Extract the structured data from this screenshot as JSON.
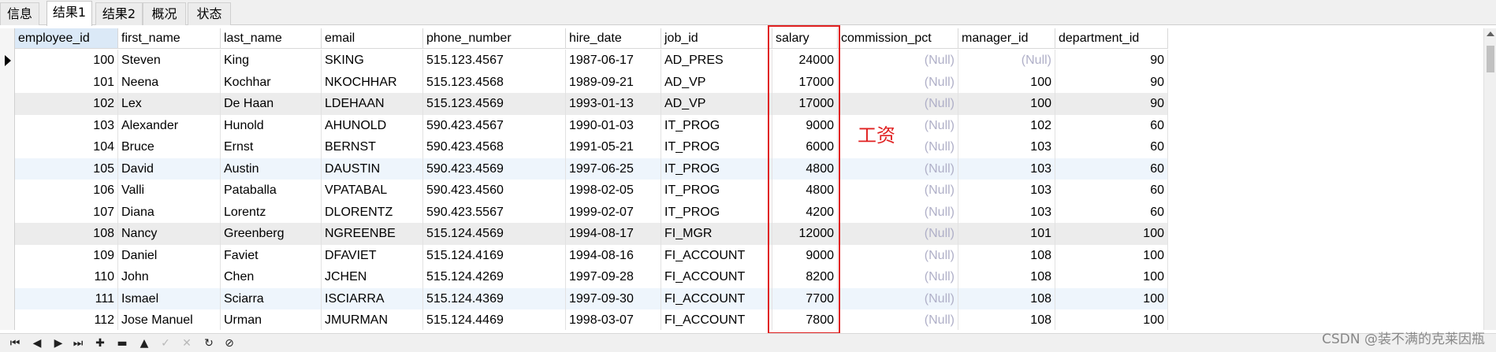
{
  "tabs": [
    {
      "label": "信息"
    },
    {
      "label": "结果1"
    },
    {
      "label": "结果2"
    },
    {
      "label": "概况"
    },
    {
      "label": "状态"
    }
  ],
  "columns": [
    "employee_id",
    "first_name",
    "last_name",
    "email",
    "phone_number",
    "hire_date",
    "job_id",
    "salary",
    "commission_pct",
    "manager_id",
    "department_id"
  ],
  "rows": [
    [
      "100",
      "Steven",
      "King",
      "SKING",
      "515.123.4567",
      "1987-06-17",
      "AD_PRES",
      "24000",
      "(Null)",
      "(Null)",
      "90"
    ],
    [
      "101",
      "Neena",
      "Kochhar",
      "NKOCHHAR",
      "515.123.4568",
      "1989-09-21",
      "AD_VP",
      "17000",
      "(Null)",
      "100",
      "90"
    ],
    [
      "102",
      "Lex",
      "De Haan",
      "LDEHAAN",
      "515.123.4569",
      "1993-01-13",
      "AD_VP",
      "17000",
      "(Null)",
      "100",
      "90"
    ],
    [
      "103",
      "Alexander",
      "Hunold",
      "AHUNOLD",
      "590.423.4567",
      "1990-01-03",
      "IT_PROG",
      "9000",
      "(Null)",
      "102",
      "60"
    ],
    [
      "104",
      "Bruce",
      "Ernst",
      "BERNST",
      "590.423.4568",
      "1991-05-21",
      "IT_PROG",
      "6000",
      "(Null)",
      "103",
      "60"
    ],
    [
      "105",
      "David",
      "Austin",
      "DAUSTIN",
      "590.423.4569",
      "1997-06-25",
      "IT_PROG",
      "4800",
      "(Null)",
      "103",
      "60"
    ],
    [
      "106",
      "Valli",
      "Pataballa",
      "VPATABAL",
      "590.423.4560",
      "1998-02-05",
      "IT_PROG",
      "4800",
      "(Null)",
      "103",
      "60"
    ],
    [
      "107",
      "Diana",
      "Lorentz",
      "DLORENTZ",
      "590.423.5567",
      "1999-02-07",
      "IT_PROG",
      "4200",
      "(Null)",
      "103",
      "60"
    ],
    [
      "108",
      "Nancy",
      "Greenberg",
      "NGREENBE",
      "515.124.4569",
      "1994-08-17",
      "FI_MGR",
      "12000",
      "(Null)",
      "101",
      "100"
    ],
    [
      "109",
      "Daniel",
      "Faviet",
      "DFAVIET",
      "515.124.4169",
      "1994-08-16",
      "FI_ACCOUNT",
      "9000",
      "(Null)",
      "108",
      "100"
    ],
    [
      "110",
      "John",
      "Chen",
      "JCHEN",
      "515.124.4269",
      "1997-09-28",
      "FI_ACCOUNT",
      "8200",
      "(Null)",
      "108",
      "100"
    ],
    [
      "111",
      "Ismael",
      "Sciarra",
      "ISCIARRA",
      "515.124.4369",
      "1997-09-30",
      "FI_ACCOUNT",
      "7700",
      "(Null)",
      "108",
      "100"
    ],
    [
      "112",
      "Jose Manuel",
      "Urman",
      "JMURMAN",
      "515.124.4469",
      "1998-03-07",
      "FI_ACCOUNT",
      "7800",
      "(Null)",
      "108",
      "100"
    ]
  ],
  "annotation": {
    "label": "工资",
    "color": "#e02020"
  },
  "toolbar": [
    {
      "glyph": "⏮",
      "name": "first-record-button"
    },
    {
      "glyph": "◀",
      "name": "prev-record-button"
    },
    {
      "glyph": "▶",
      "name": "next-record-button"
    },
    {
      "glyph": "⏭",
      "name": "last-record-button"
    },
    {
      "glyph": "✚",
      "name": "add-record-button"
    },
    {
      "glyph": "▬",
      "name": "delete-record-button"
    },
    {
      "glyph": "▲",
      "name": "apply-changes-button"
    },
    {
      "glyph": "✓",
      "name": "commit-button",
      "disabled": true
    },
    {
      "glyph": "✕",
      "name": "discard-button",
      "disabled": true
    },
    {
      "glyph": "↻",
      "name": "refresh-icon"
    },
    {
      "glyph": "⊘",
      "name": "stop-icon"
    }
  ],
  "watermark": "CSDN @装不满的克莱因瓶"
}
